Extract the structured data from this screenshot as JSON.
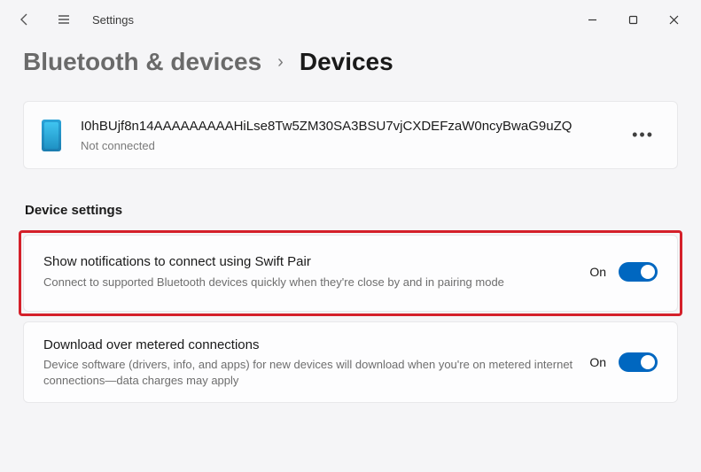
{
  "app": {
    "title": "Settings"
  },
  "breadcrumb": {
    "parent": "Bluetooth & devices",
    "separator": "›",
    "current": "Devices"
  },
  "device": {
    "name": "I0hBUjf8n14AAAAAAAAAHiLse8Tw5ZM30SA3BSU7vjCXDEFzaW0ncyBwaG9uZQ",
    "status": "Not connected"
  },
  "sections": {
    "device_settings_header": "Device settings"
  },
  "settings": {
    "swift_pair": {
      "title": "Show notifications to connect using Swift Pair",
      "desc": "Connect to supported Bluetooth devices quickly when they're close by and in pairing mode",
      "state_label": "On",
      "on": true
    },
    "metered": {
      "title": "Download over metered connections",
      "desc": "Device software (drivers, info, and apps) for new devices will download when you're on metered internet connections—data charges may apply",
      "state_label": "On",
      "on": true
    }
  }
}
